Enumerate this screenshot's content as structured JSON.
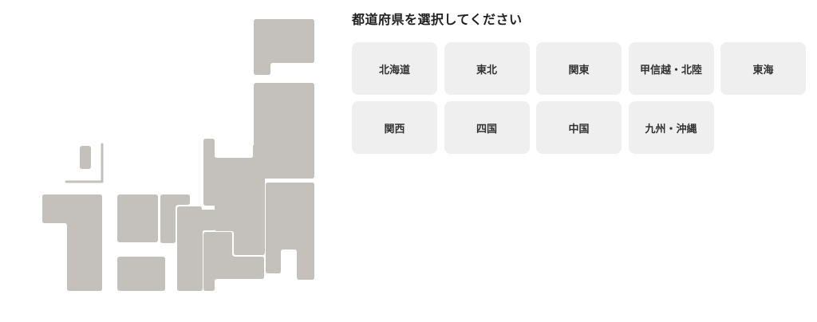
{
  "title": "都道府県を選択してください",
  "colors": {
    "map_fill": "#c4c1bc",
    "button_bg": "#efefef",
    "text": "#333333"
  },
  "regions": [
    {
      "label": "北海道"
    },
    {
      "label": "東北"
    },
    {
      "label": "関東"
    },
    {
      "label": "甲信越・北陸"
    },
    {
      "label": "東海"
    },
    {
      "label": "関西"
    },
    {
      "label": "四国"
    },
    {
      "label": "中国"
    },
    {
      "label": "九州・沖縄"
    }
  ]
}
